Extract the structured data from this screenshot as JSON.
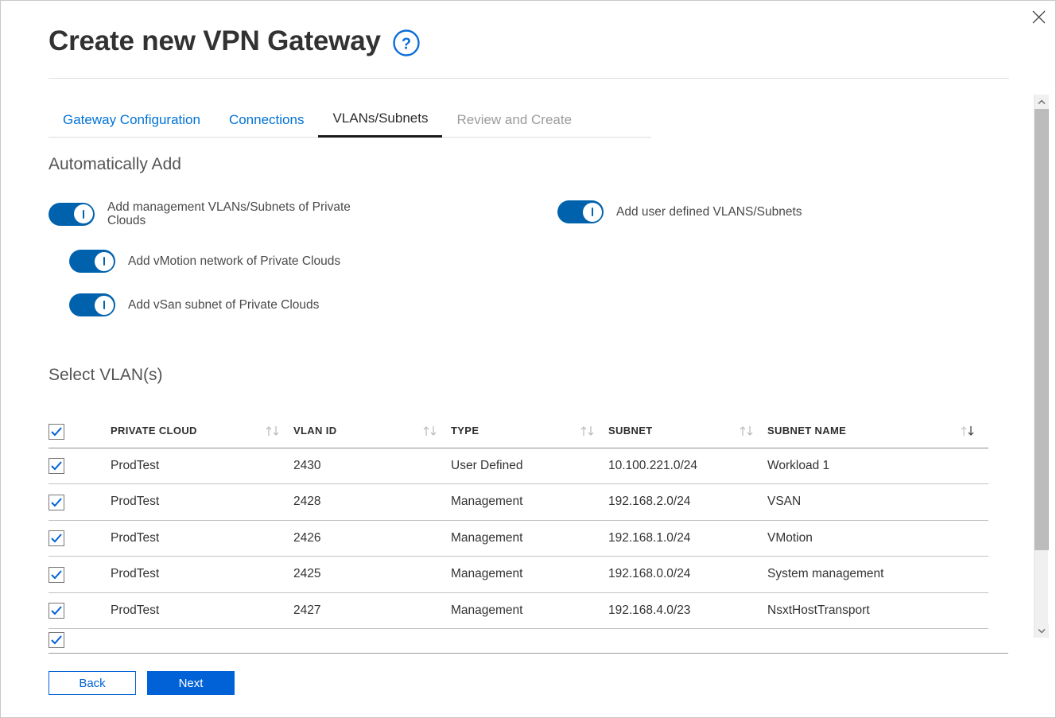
{
  "window": {
    "close_icon": "close-icon"
  },
  "header": {
    "title": "Create new VPN Gateway",
    "help_icon": "help-circle-icon"
  },
  "tabs": [
    {
      "label": "Gateway Configuration",
      "state": "link"
    },
    {
      "label": "Connections",
      "state": "link"
    },
    {
      "label": "VLANs/Subnets",
      "state": "active"
    },
    {
      "label": "Review and Create",
      "state": "disabled"
    }
  ],
  "auto_add": {
    "section_title": "Automatically Add",
    "toggles": [
      {
        "label": "Add management VLANs/Subnets of Private Clouds",
        "on": true
      },
      {
        "label": "Add user defined VLANS/Subnets",
        "on": true
      },
      {
        "label": "Add vMotion network of Private Clouds",
        "on": true
      },
      {
        "label": "Add vSan subnet of Private Clouds",
        "on": true
      }
    ]
  },
  "select_vlans": {
    "section_title": "Select VLAN(s)",
    "select_all_checked": true,
    "columns": [
      {
        "label": "PRIVATE CLOUD",
        "sortable": true
      },
      {
        "label": "VLAN ID",
        "sortable": true
      },
      {
        "label": "TYPE",
        "sortable": true
      },
      {
        "label": "SUBNET",
        "sortable": true
      },
      {
        "label": "SUBNET NAME",
        "sortable": true,
        "sort_active": "desc"
      }
    ],
    "rows": [
      {
        "checked": true,
        "private_cloud": "ProdTest",
        "vlan_id": "2430",
        "type": "User Defined",
        "subnet": "10.100.221.0/24",
        "subnet_name": "Workload 1"
      },
      {
        "checked": true,
        "private_cloud": "ProdTest",
        "vlan_id": "2428",
        "type": "Management",
        "subnet": "192.168.2.0/24",
        "subnet_name": "VSAN"
      },
      {
        "checked": true,
        "private_cloud": "ProdTest",
        "vlan_id": "2426",
        "type": "Management",
        "subnet": "192.168.1.0/24",
        "subnet_name": "VMotion"
      },
      {
        "checked": true,
        "private_cloud": "ProdTest",
        "vlan_id": "2425",
        "type": "Management",
        "subnet": "192.168.0.0/24",
        "subnet_name": "System management"
      },
      {
        "checked": true,
        "private_cloud": "ProdTest",
        "vlan_id": "2427",
        "type": "Management",
        "subnet": "192.168.4.0/23",
        "subnet_name": "NsxtHostTransport"
      }
    ]
  },
  "footer": {
    "back_label": "Back",
    "next_label": "Next"
  },
  "scrollbar": {
    "up_icon": "chevron-up-icon",
    "down_icon": "chevron-down-icon"
  },
  "colors": {
    "accent": "#0062d6",
    "toggle_on": "#0062ad",
    "tab_link": "#0072d6",
    "text": "#333333"
  }
}
